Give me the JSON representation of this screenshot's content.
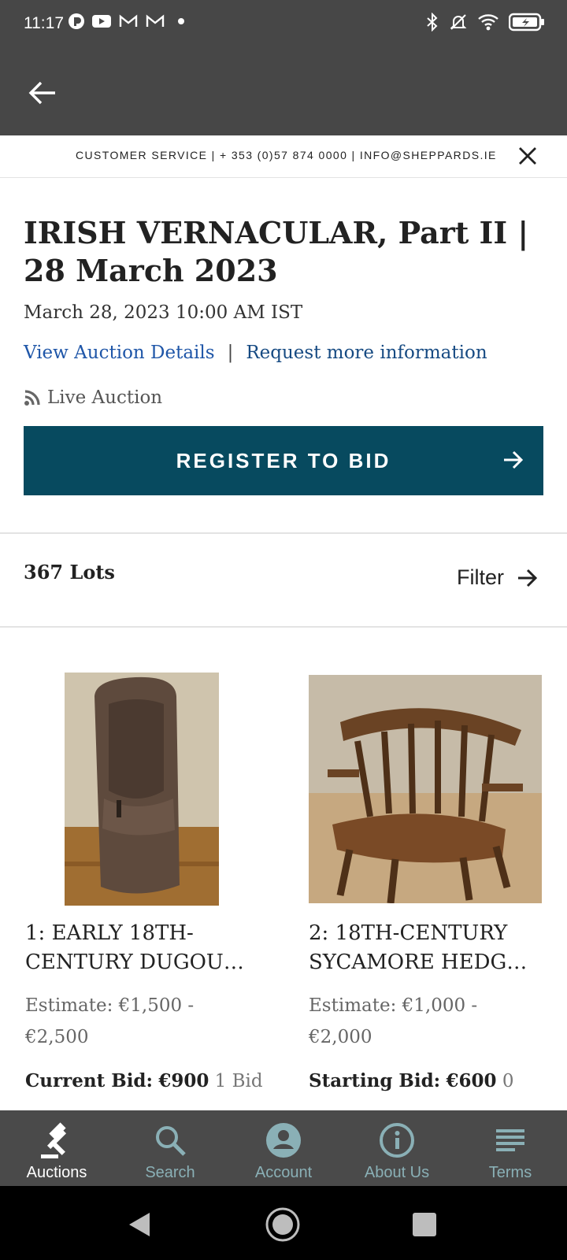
{
  "status_bar": {
    "time": "11:17"
  },
  "customer_service": {
    "text": "CUSTOMER SERVICE | + 353 (0)57 874 0000 | INFO@SHEPPARDS.IE"
  },
  "auction": {
    "title": "IRISH VERNACULAR, Part II | 28 March 2023",
    "date": "March 28, 2023 10:00 AM IST",
    "view_details": "View Auction Details",
    "separator": "|",
    "request_info": "Request more information",
    "live_label": "Live Auction",
    "register_label": "REGISTER TO BID"
  },
  "lots_bar": {
    "count": "367 Lots",
    "filter": "Filter"
  },
  "lots": [
    {
      "title": "1: EARLY 18TH-CENTURY DUGOU…",
      "estimate": "Estimate: €1,500 - €2,500",
      "bid_label": "Current Bid:",
      "bid_value": "€900",
      "bid_count": "1 Bid"
    },
    {
      "title": "2: 18TH-CENTURY SYCAMORE HEDG…",
      "estimate": "Estimate: €1,000 - €2,000",
      "bid_label": "Starting Bid:",
      "bid_value": "€600",
      "bid_count": "0"
    }
  ],
  "bottom_nav": [
    {
      "label": "Auctions",
      "icon": "gavel-icon",
      "active": true
    },
    {
      "label": "Search",
      "icon": "search-icon",
      "active": false
    },
    {
      "label": "Account",
      "icon": "account-icon",
      "active": false
    },
    {
      "label": "About Us",
      "icon": "info-icon",
      "active": false
    },
    {
      "label": "Terms",
      "icon": "terms-icon",
      "active": false
    }
  ],
  "colors": {
    "app_bar": "#474747",
    "register_button": "#074a5f",
    "link_blue": "#1f56a8",
    "nav_active": "#ffffff",
    "nav_inactive": "#8ab0b6"
  }
}
